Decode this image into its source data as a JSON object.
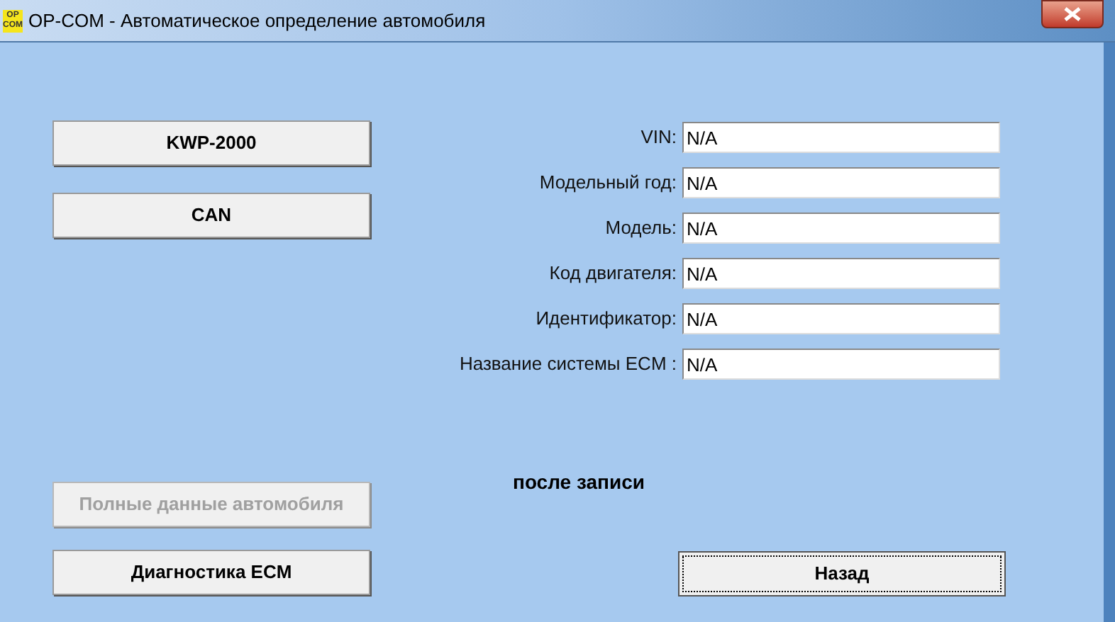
{
  "window": {
    "title": "OP-COM - Автоматическое определение автомобиля",
    "logo": "OP COM"
  },
  "protocol_buttons": [
    {
      "label": "KWP-2000",
      "disabled": false
    },
    {
      "label": "CAN",
      "disabled": false
    }
  ],
  "fields": [
    {
      "label": "VIN:",
      "value": "N/A"
    },
    {
      "label": "Модельный год:",
      "value": "N/A"
    },
    {
      "label": "Модель:",
      "value": "N/A"
    },
    {
      "label": "Код двигателя:",
      "value": "N/A"
    },
    {
      "label": "Идентификатор:",
      "value": "N/A"
    },
    {
      "label": "Название системы ECM :",
      "value": "N/A"
    }
  ],
  "status": "после записи",
  "action_buttons": [
    {
      "label": "Полные данные автомобиля",
      "disabled": true
    },
    {
      "label": "Диагностика ECM",
      "disabled": false
    }
  ],
  "back_button": {
    "label": "Назад",
    "focused": true
  }
}
